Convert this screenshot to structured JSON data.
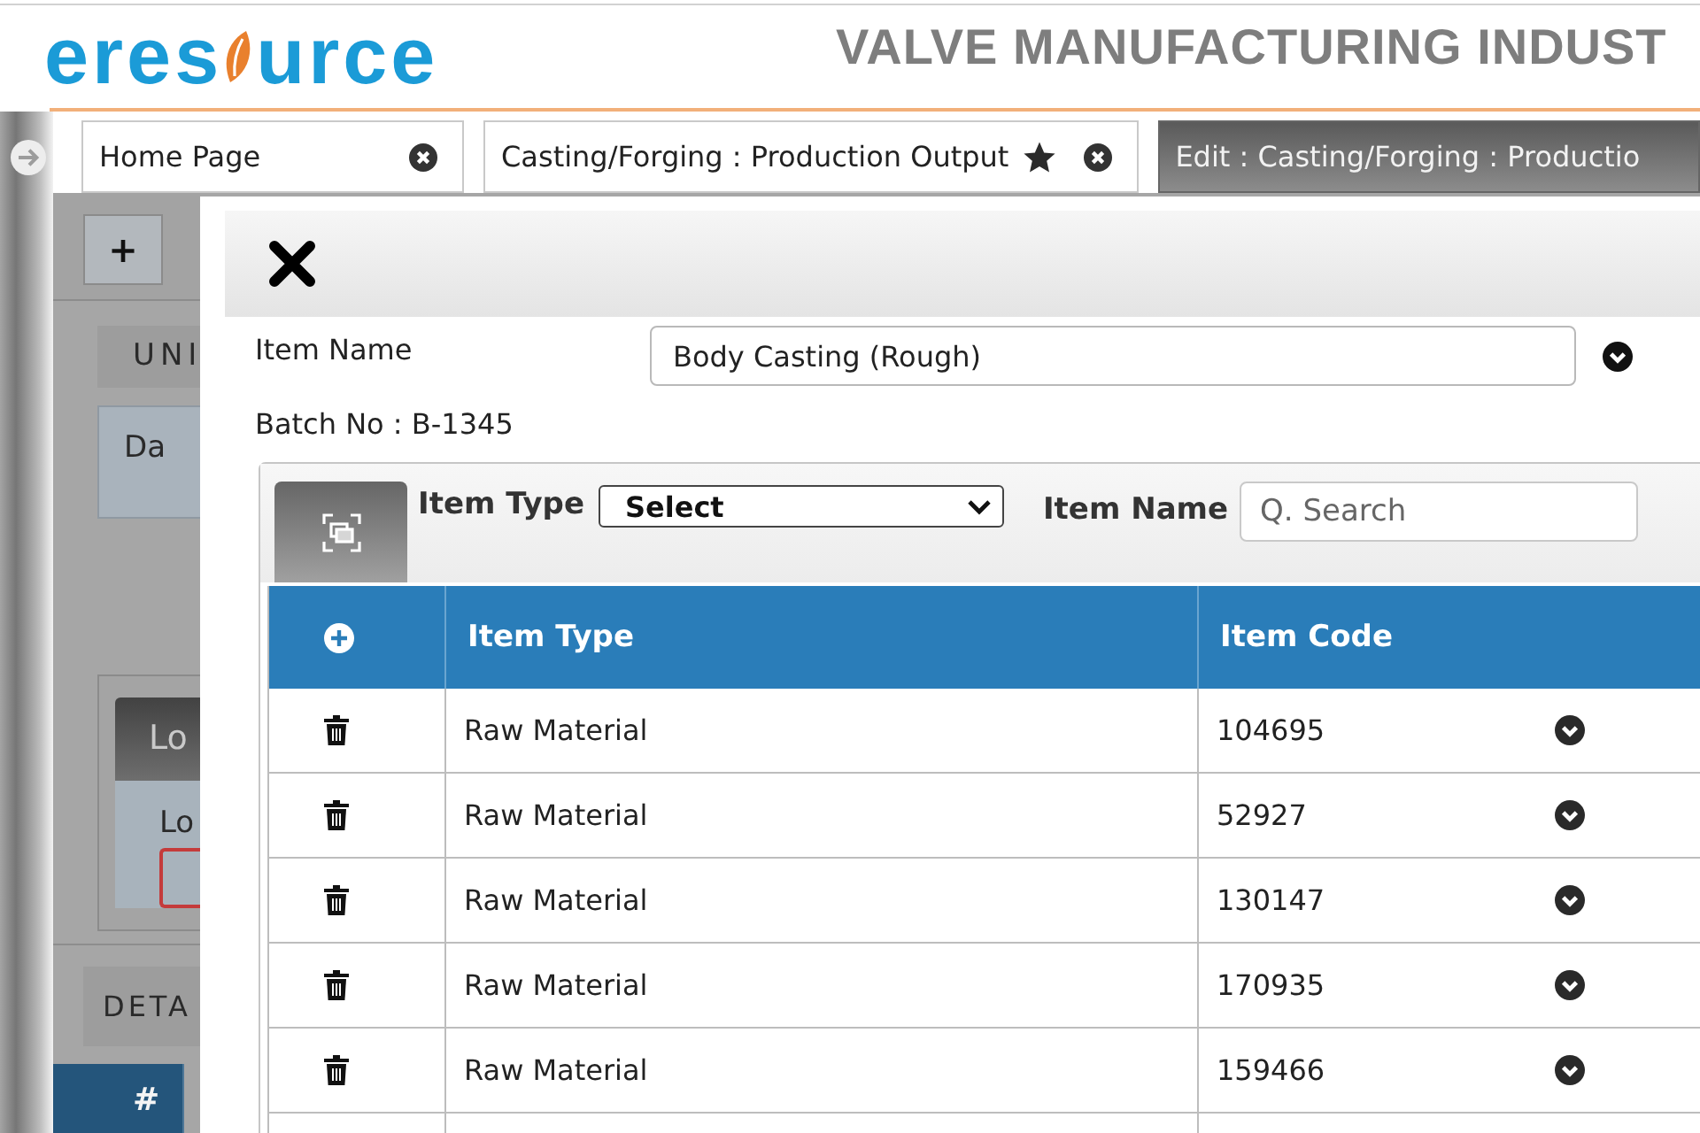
{
  "header": {
    "logo": {
      "before": "eres",
      "after": "urce"
    },
    "title": "VALVE MANUFACTURING INDUST"
  },
  "tabs": [
    {
      "label": "Home Page",
      "starred": false,
      "closable": true,
      "selected": false
    },
    {
      "label": "Casting/Forging : Production Output",
      "starred": true,
      "closable": true,
      "selected": false
    },
    {
      "label": "Edit : Casting/Forging : Productio",
      "starred": false,
      "closable": false,
      "selected": true
    }
  ],
  "background_page": {
    "add_button": "+",
    "heading_1": "UNI",
    "box_label": "Da",
    "panel_button": "Lo",
    "field_label": "Lo",
    "heading_2": "DETA",
    "grid_column": "#"
  },
  "dialog": {
    "field": {
      "label": "Item Name",
      "value": "Body Casting (Rough)"
    },
    "batch": "Batch No : B-1345",
    "filters": [
      {
        "kind": "select",
        "label": "Item Type",
        "value": "Select"
      },
      {
        "kind": "search",
        "label": "Item Name",
        "placeholder": "Q. Search"
      }
    ],
    "table": {
      "columns": [
        "Item Type",
        "Item Code"
      ],
      "rows": [
        {
          "item_type": "Raw Material",
          "item_code": "104695"
        },
        {
          "item_type": "Raw Material",
          "item_code": "52927"
        },
        {
          "item_type": "Raw Material",
          "item_code": "130147"
        },
        {
          "item_type": "Raw Material",
          "item_code": "170935"
        },
        {
          "item_type": "Raw Material",
          "item_code": "159466"
        }
      ]
    }
  }
}
